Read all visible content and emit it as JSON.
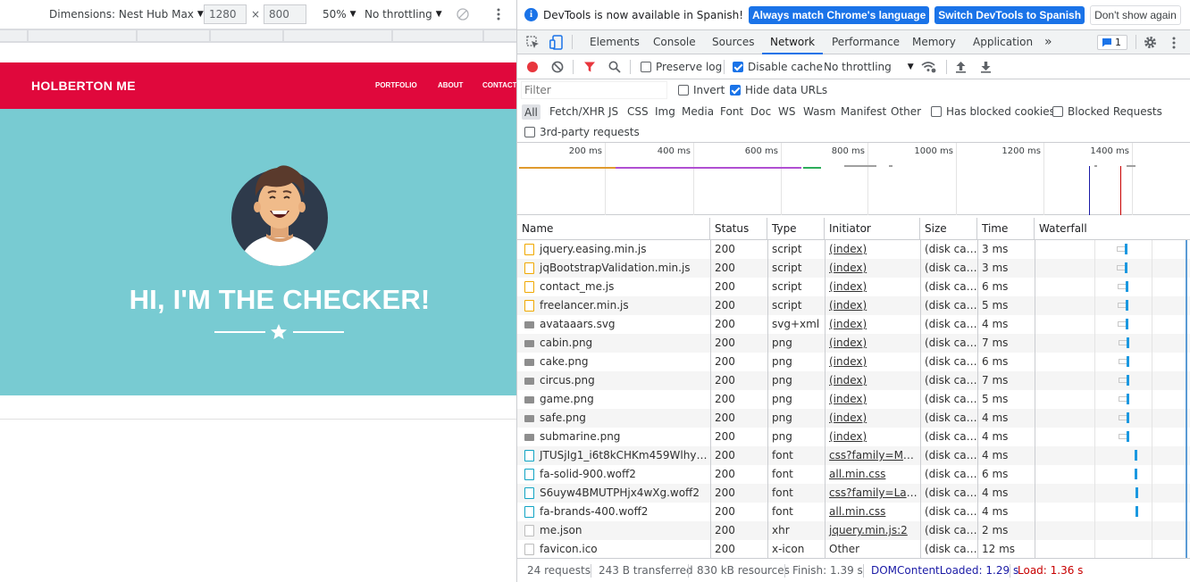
{
  "device_toolbar": {
    "dimensions_label": "Dimensions: Nest Hub Max",
    "width": "1280",
    "times": "×",
    "height": "800",
    "zoom": "50%",
    "throttling": "No throttling"
  },
  "site": {
    "brand": "HOLBERTON ME",
    "nav": [
      "PORTFOLIO",
      "ABOUT",
      "CONTACT"
    ],
    "hero_title": "HI, I'M THE CHECKER!"
  },
  "infobar": {
    "message": "DevTools is now available in Spanish!",
    "btn_match": "Always match Chrome's language",
    "btn_switch": "Switch DevTools to Spanish",
    "btn_dismiss": "Don't show again"
  },
  "tabs": [
    "Elements",
    "Console",
    "Sources",
    "Network",
    "Performance",
    "Memory",
    "Application"
  ],
  "tabs_more": "»",
  "issues_count": "1",
  "net_toolbar": {
    "preserve_log": "Preserve log",
    "disable_cache": "Disable cache",
    "throttling": "No throttling"
  },
  "filter": {
    "placeholder": "Filter",
    "invert": "Invert",
    "hide_data_urls": "Hide data URLs"
  },
  "types": [
    "All",
    "Fetch/XHR",
    "JS",
    "CSS",
    "Img",
    "Media",
    "Font",
    "Doc",
    "WS",
    "Wasm",
    "Manifest",
    "Other"
  ],
  "blocked_cookies": "Has blocked cookies",
  "blocked_requests": "Blocked Requests",
  "third_party": "3rd-party requests",
  "overview_ticks": [
    "200 ms",
    "400 ms",
    "600 ms",
    "800 ms",
    "1000 ms",
    "1200 ms",
    "1400 ms"
  ],
  "columns": [
    "Name",
    "Status",
    "Type",
    "Initiator",
    "Size",
    "Time",
    "Waterfall"
  ],
  "rows": [
    {
      "name": "jquery.easing.min.js",
      "status": "200",
      "type": "script",
      "initiator": "(index)",
      "size": "(disk cac...",
      "time": "3 ms",
      "kind": "script"
    },
    {
      "name": "jqBootstrapValidation.min.js",
      "status": "200",
      "type": "script",
      "initiator": "(index)",
      "size": "(disk cac...",
      "time": "3 ms",
      "kind": "script"
    },
    {
      "name": "contact_me.js",
      "status": "200",
      "type": "script",
      "initiator": "(index)",
      "size": "(disk cac...",
      "time": "6 ms",
      "kind": "script"
    },
    {
      "name": "freelancer.min.js",
      "status": "200",
      "type": "script",
      "initiator": "(index)",
      "size": "(disk cac...",
      "time": "5 ms",
      "kind": "script"
    },
    {
      "name": "avataaars.svg",
      "status": "200",
      "type": "svg+xml",
      "initiator": "(index)",
      "size": "(disk cac...",
      "time": "4 ms",
      "kind": "img"
    },
    {
      "name": "cabin.png",
      "status": "200",
      "type": "png",
      "initiator": "(index)",
      "size": "(disk cac...",
      "time": "7 ms",
      "kind": "img"
    },
    {
      "name": "cake.png",
      "status": "200",
      "type": "png",
      "initiator": "(index)",
      "size": "(disk cac...",
      "time": "6 ms",
      "kind": "img"
    },
    {
      "name": "circus.png",
      "status": "200",
      "type": "png",
      "initiator": "(index)",
      "size": "(disk cac...",
      "time": "7 ms",
      "kind": "img"
    },
    {
      "name": "game.png",
      "status": "200",
      "type": "png",
      "initiator": "(index)",
      "size": "(disk cac...",
      "time": "5 ms",
      "kind": "img"
    },
    {
      "name": "safe.png",
      "status": "200",
      "type": "png",
      "initiator": "(index)",
      "size": "(disk cac...",
      "time": "4 ms",
      "kind": "img"
    },
    {
      "name": "submarine.png",
      "status": "200",
      "type": "png",
      "initiator": "(index)",
      "size": "(disk cac...",
      "time": "4 ms",
      "kind": "img"
    },
    {
      "name": "JTUSjIg1_i6t8kCHKm459Wlhyw.w...",
      "status": "200",
      "type": "font",
      "initiator": "css?family=Mon...",
      "size": "(disk cac...",
      "time": "4 ms",
      "kind": "font"
    },
    {
      "name": "fa-solid-900.woff2",
      "status": "200",
      "type": "font",
      "initiator": "all.min.css",
      "size": "(disk cac...",
      "time": "6 ms",
      "kind": "font"
    },
    {
      "name": "S6uyw4BMUTPHjx4wXg.woff2",
      "status": "200",
      "type": "font",
      "initiator": "css?family=Lato:...",
      "size": "(disk cac...",
      "time": "4 ms",
      "kind": "font"
    },
    {
      "name": "fa-brands-400.woff2",
      "status": "200",
      "type": "font",
      "initiator": "all.min.css",
      "size": "(disk cac...",
      "time": "4 ms",
      "kind": "font"
    },
    {
      "name": "me.json",
      "status": "200",
      "type": "xhr",
      "initiator": "jquery.min.js:2",
      "size": "(disk cac...",
      "time": "2 ms",
      "kind": "doc"
    },
    {
      "name": "favicon.ico",
      "status": "200",
      "type": "x-icon",
      "initiator": "Other",
      "size": "(disk cac...",
      "time": "12 ms",
      "kind": "doc"
    }
  ],
  "status_bar": {
    "requests": "24 requests",
    "transferred": "243 B transferred",
    "resources": "830 kB resources",
    "finish": "Finish: 1.39 s",
    "dom_loaded": "DOMContentLoaded: 1.29 s",
    "load": "Load: 1.36 s"
  },
  "colors": {
    "site_nav": "#e0083c",
    "hero_bg": "#78cbd2",
    "accent": "#1a73e8",
    "dom_loaded": "#1a1aa6",
    "load": "#c80000"
  }
}
